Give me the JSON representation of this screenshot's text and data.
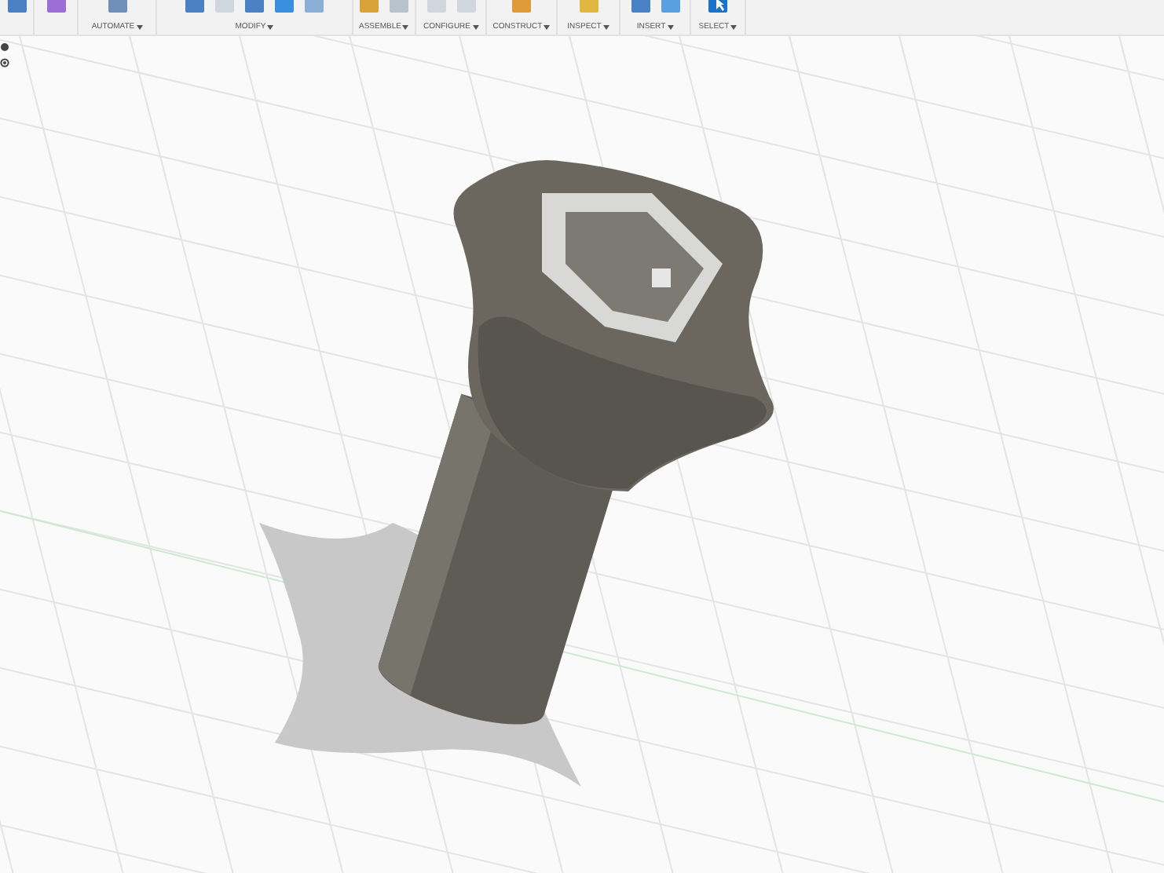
{
  "toolbar": {
    "groups": [
      {
        "label": "AUTOMATE"
      },
      {
        "label": "MODIFY"
      },
      {
        "label": "ASSEMBLE"
      },
      {
        "label": "CONFIGURE"
      },
      {
        "label": "CONSTRUCT"
      },
      {
        "label": "INSPECT"
      },
      {
        "label": "INSERT"
      },
      {
        "label": "SELECT"
      }
    ]
  }
}
